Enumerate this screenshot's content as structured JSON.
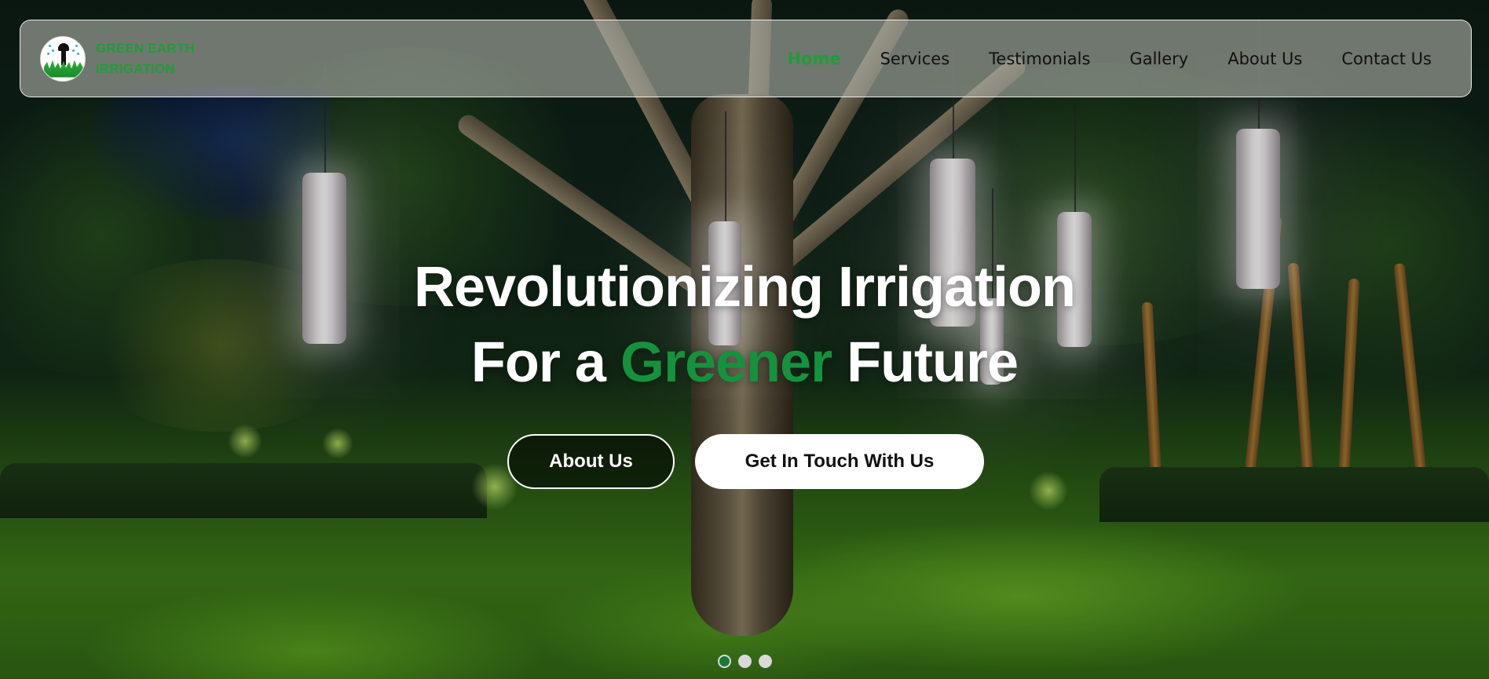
{
  "brand": {
    "line1": "GREEN EARTH",
    "line2": "IRRIGATION",
    "color": "#1f9c3a"
  },
  "nav": {
    "items": [
      {
        "label": "Home",
        "active": true
      },
      {
        "label": "Services",
        "active": false
      },
      {
        "label": "Testimonials",
        "active": false
      },
      {
        "label": "Gallery",
        "active": false
      },
      {
        "label": "About Us",
        "active": false
      },
      {
        "label": "Contact Us",
        "active": false
      }
    ]
  },
  "hero": {
    "line1": "Revolutionizing Irrigation",
    "line2_prefix": "For a ",
    "line2_accent": "Greener",
    "line2_suffix": " Future",
    "accent_color": "#15923d"
  },
  "buttons": {
    "about_label": "About Us",
    "contact_label": "Get In Touch With Us"
  },
  "carousel": {
    "slide_count": 3,
    "active_index": 0
  }
}
